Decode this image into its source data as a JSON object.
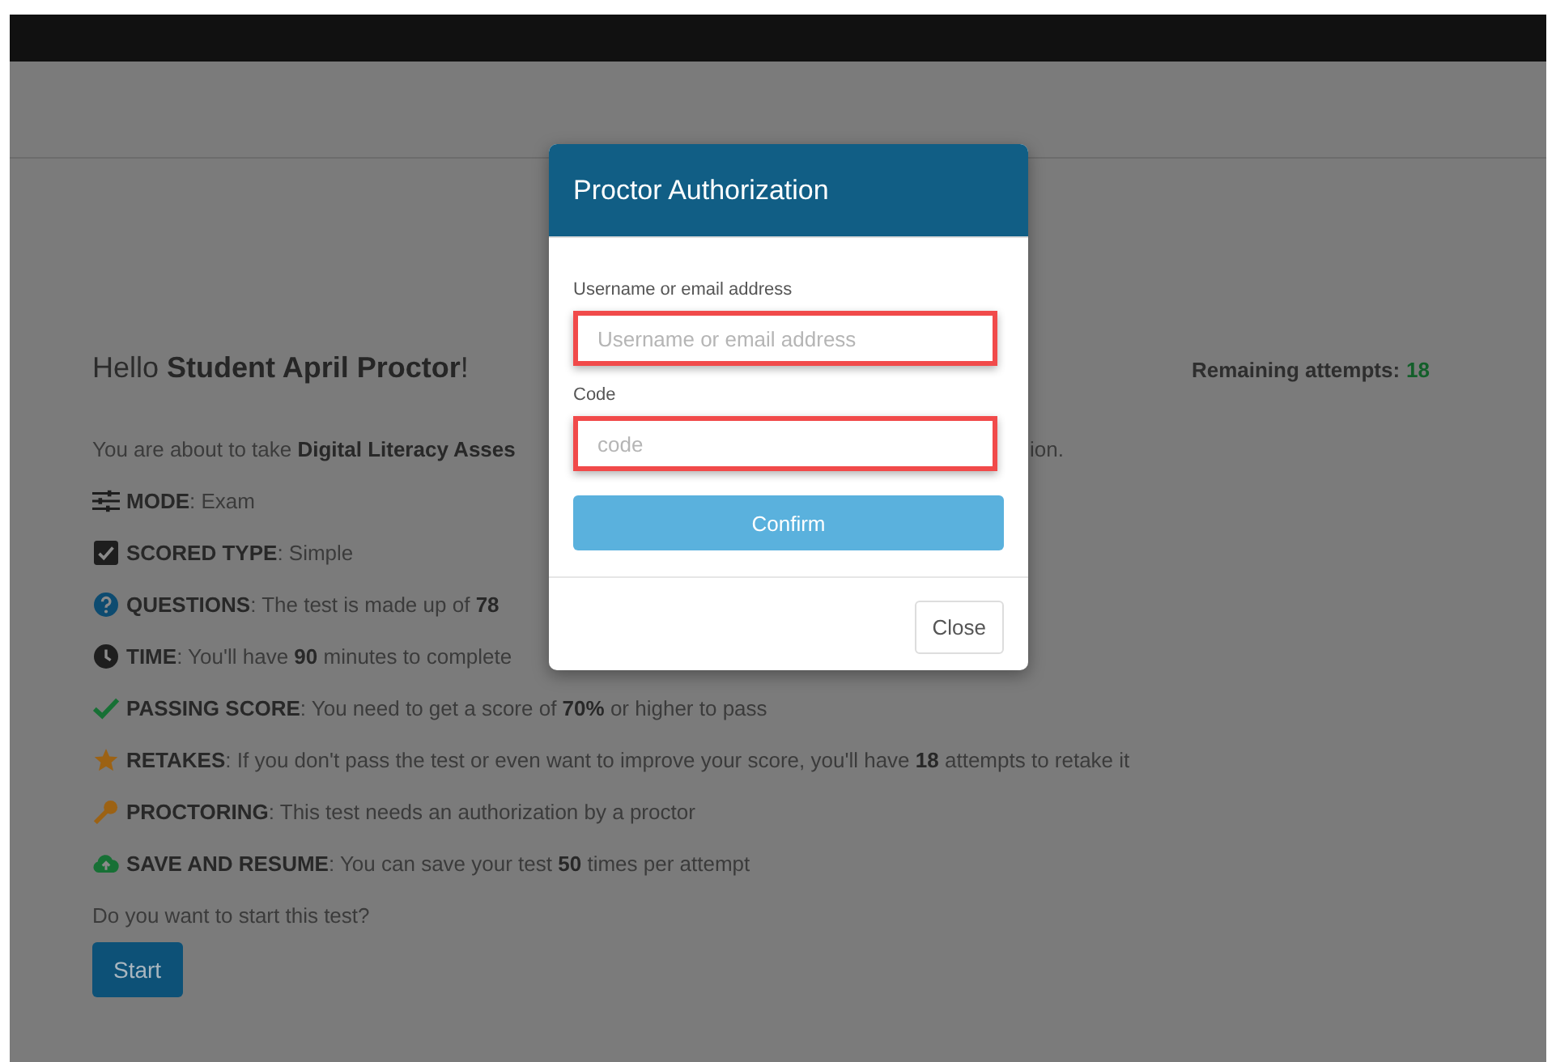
{
  "greeting": "Hello **Student April Proctor**!",
  "remaining": {
    "label": "Remaining attempts:",
    "value": "18"
  },
  "intro": {
    "left": "You are about to take **Digital Literacy Asses**",
    "right": "ion."
  },
  "details": [
    {
      "kind": "sliders",
      "text": "**MODE**: Exam"
    },
    {
      "kind": "checkbox",
      "text": "**SCORED TYPE**: Simple"
    },
    {
      "kind": "question",
      "text": "**QUESTIONS**: The test is made up of **78**"
    },
    {
      "kind": "clock",
      "text": "**TIME**: You'll have **90** minutes to complete"
    },
    {
      "kind": "check",
      "text": "**PASSING SCORE**: You need to get a score of **70%** or higher to pass"
    },
    {
      "kind": "star",
      "text": "**RETAKES**: If you don't pass the test or even want to improve your score, you'll have **18** attempts to retake it"
    },
    {
      "kind": "key",
      "text": "**PROCTORING**: This test needs an authorization by a proctor"
    },
    {
      "kind": "cloud",
      "text": "**SAVE AND RESUME**: You can save your test **50** times per attempt"
    }
  ],
  "prompt": "Do you want to start this test?",
  "start_button": "Start",
  "modal": {
    "title": "Proctor Authorization",
    "fields": [
      {
        "label": "Username or email address",
        "placeholder": "Username or email address",
        "highlighted": true
      },
      {
        "label": "Code",
        "placeholder": "code",
        "highlighted": true
      }
    ],
    "confirm_button": "Confirm",
    "close_button": "Close"
  }
}
